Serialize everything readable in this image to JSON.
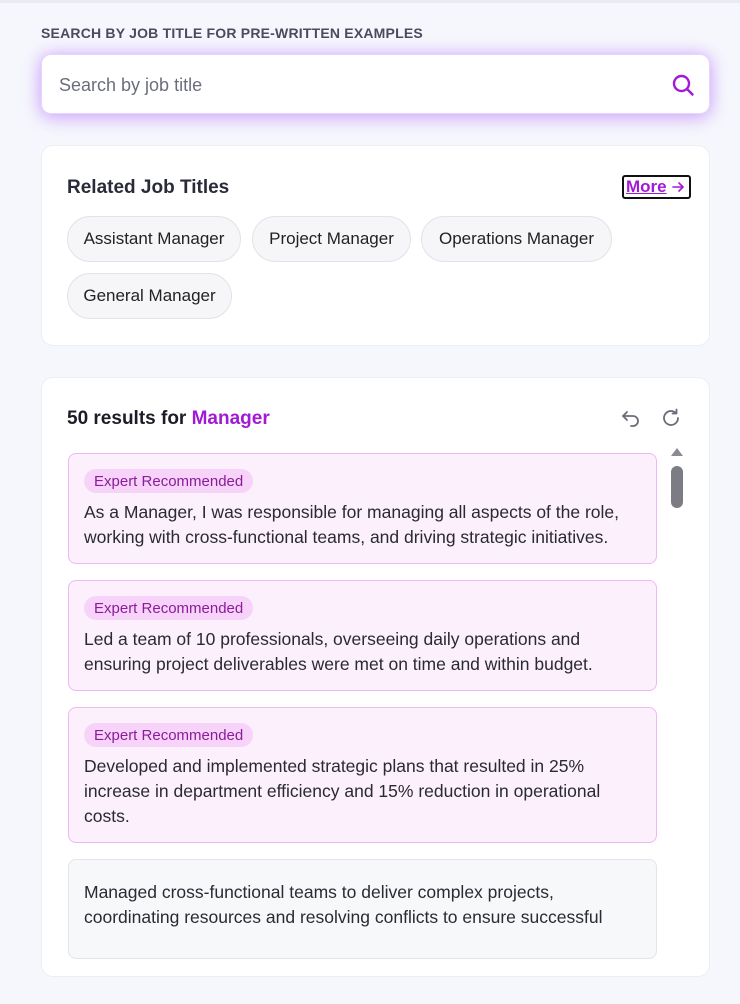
{
  "search": {
    "heading": "SEARCH BY JOB TITLE FOR PRE-WRITTEN EXAMPLES",
    "placeholder": "Search by job title",
    "value": ""
  },
  "related": {
    "title": "Related Job Titles",
    "more_label": "More",
    "chips": [
      "Assistant Manager",
      "Project Manager",
      "Operations Manager",
      "General Manager"
    ]
  },
  "results": {
    "count_text": "50 results for",
    "term": "Manager",
    "examples": [
      {
        "badge": "Expert Recommended",
        "text": "As a Manager, I was responsible for managing all aspects of the role, working with cross-functional teams, and driving strategic initiatives."
      },
      {
        "badge": "Expert Recommended",
        "text": "Led a team of 10 professionals, overseeing daily operations and ensuring project deliverables were met on time and within budget."
      },
      {
        "badge": "Expert Recommended",
        "text": "Developed and implemented strategic plans that resulted in 25% increase in department efficiency and 15% reduction in operational costs."
      },
      {
        "badge": "",
        "text": "Managed cross-functional teams to deliver complex projects, coordinating resources and resolving conflicts to ensure successful"
      }
    ]
  },
  "icons": {
    "search": "search-icon",
    "more": "arrow-right-icon",
    "undo": "undo-icon",
    "refresh": "refresh-icon"
  },
  "colors": {
    "accent": "#a219d6",
    "badge_bg": "#f7d3f9",
    "recommended_bg": "#fcf0fd"
  }
}
